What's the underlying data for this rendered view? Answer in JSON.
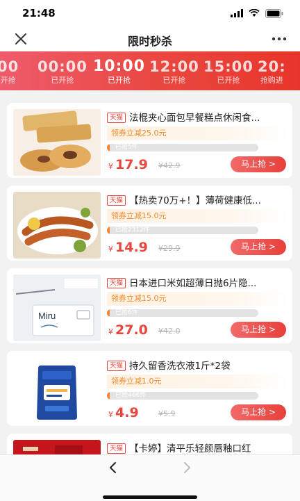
{
  "status_bar": {
    "time": "21:48",
    "icons": [
      "cellular-signal-icon",
      "wifi-icon",
      "battery-icon"
    ]
  },
  "nav": {
    "title": "限时秒杀",
    "close_icon": "close-icon",
    "more_icon": "more-icon"
  },
  "time_slots": [
    {
      "time": "00",
      "status": "开抢"
    },
    {
      "time": "00:00",
      "status": "已开抢"
    },
    {
      "time": "10:00",
      "status": "已开抢",
      "active": true
    },
    {
      "time": "12:00",
      "status": "已开抢"
    },
    {
      "time": "15:00",
      "status": "已开抢"
    },
    {
      "time": "20:",
      "status": "抢购进"
    }
  ],
  "products": [
    {
      "badge": "天猫",
      "title": "法棍夹心面包早餐糕点休闲食...",
      "coupon": "领券立减25.0元",
      "sold": "已抢5件",
      "sold_fraction": 0.02,
      "price_symbol": "¥",
      "price": "17.9",
      "original_price": "¥42.9",
      "button": "马上抢 >"
    },
    {
      "badge": "天猫",
      "title": "【热卖70万+！】薄荷健康低...",
      "coupon": "领券立减15.0元",
      "sold": "已抢2312件",
      "sold_fraction": 0.02,
      "price_symbol": "¥",
      "price": "14.9",
      "original_price": "¥29.9",
      "button": "马上抢 >"
    },
    {
      "badge": "天猫",
      "title": "日本进口米如超薄日抛6片隐...",
      "coupon": "领券立减15.0元",
      "sold": "已抢6件",
      "sold_fraction": 0.02,
      "price_symbol": "¥",
      "price": "27.0",
      "original_price": "¥42.0",
      "button": "马上抢 >",
      "image_text": "Miru"
    },
    {
      "badge": "天猫",
      "title": "持久留香洗衣液1斤*2袋",
      "coupon": "领券立减1.0元",
      "sold": "已抢466件",
      "sold_fraction": 0.02,
      "price_symbol": "¥",
      "price": "4.9",
      "original_price": "¥5.9",
      "button": "马上抢 >"
    },
    {
      "badge": "天猫",
      "title": "【卡婷】清平乐轻颜唇釉口红",
      "coupon": "",
      "sold": "",
      "sold_fraction": 0,
      "price_symbol": "",
      "price": "",
      "original_price": "",
      "button": ""
    }
  ],
  "bottom_nav": {
    "back_icon": "chevron-left-icon",
    "forward_icon": "chevron-right-icon"
  },
  "colors": {
    "accent": "#e8453c",
    "banner_start": "#ee5b6b",
    "banner_end": "#e7352b",
    "coupon_text": "#f08a2a",
    "progress_fill": "#f4842f"
  }
}
